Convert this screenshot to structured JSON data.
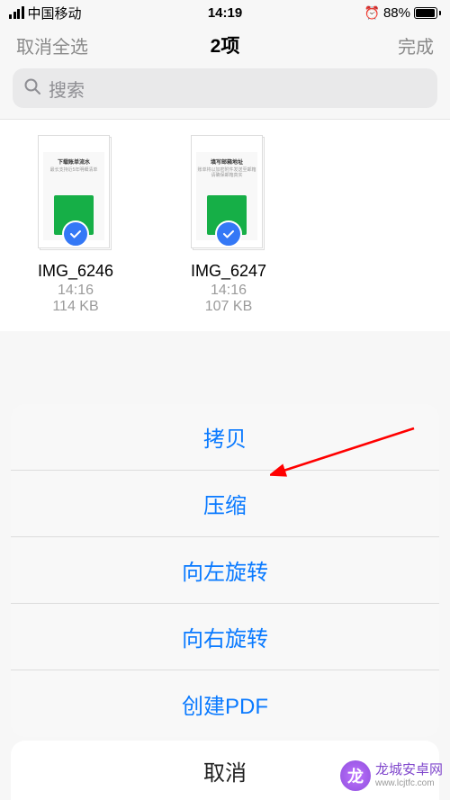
{
  "status_bar": {
    "carrier": "中国移动",
    "time": "14:19",
    "battery_pct": "88%"
  },
  "nav": {
    "left": "取消全选",
    "title": "2项",
    "right": "完成"
  },
  "search": {
    "placeholder": "搜索"
  },
  "files": [
    {
      "name": "IMG_6246",
      "time": "14:16",
      "size": "114 KB",
      "thumb_title": "下载账单流水",
      "thumb_sub": "最长支持近5年明细清单"
    },
    {
      "name": "IMG_6247",
      "time": "14:16",
      "size": "107 KB",
      "thumb_title": "填写邮箱地址",
      "thumb_sub": "账单将以加密附件发送至邮箱请确保邮箱真实"
    }
  ],
  "sheet": {
    "items": [
      "拷贝",
      "压缩",
      "向左旋转",
      "向右旋转",
      "创建PDF"
    ],
    "cancel": "取消"
  },
  "watermark": {
    "line1": "龙城安卓网",
    "line2": "www.lcjtfc.com"
  }
}
